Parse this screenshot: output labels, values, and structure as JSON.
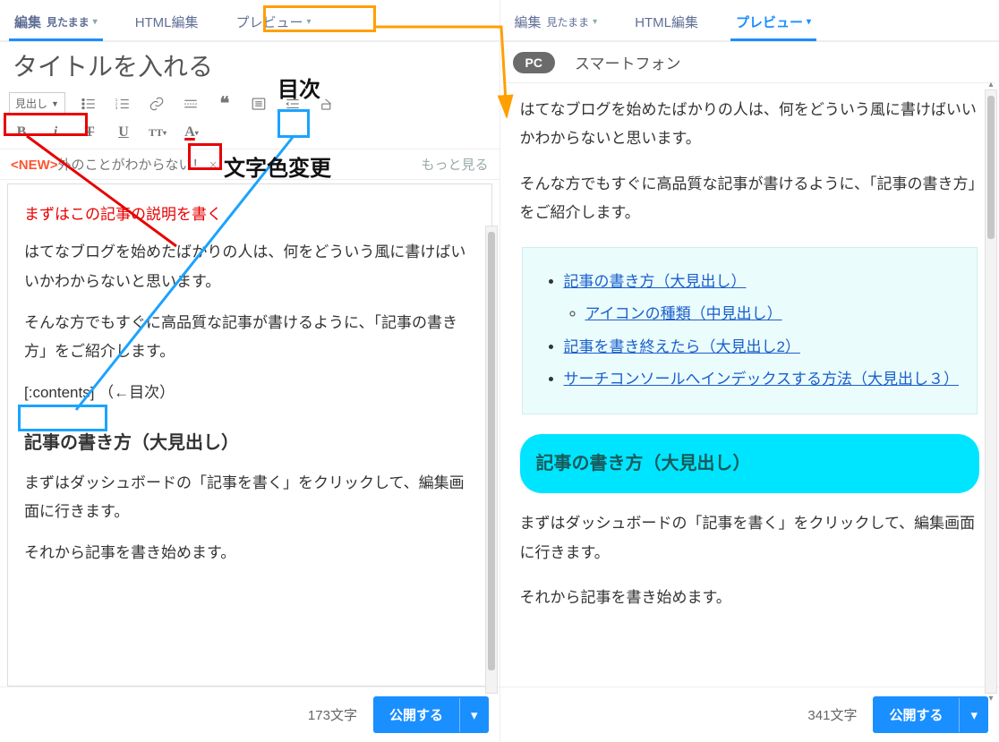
{
  "left": {
    "tabs": {
      "edit": "編集",
      "edit_small": "見たまま",
      "html": "HTML編集",
      "preview": "プレビュー"
    },
    "title_value": "タイトルを入れる",
    "heading_select": "見出し",
    "notice_new": "<NEW>",
    "notice_body": "外のことがわからない！",
    "notice_close": "×",
    "notice_more": "もっと見る",
    "body": {
      "red_line": "まずはこの記事の説明を書く",
      "p1": "はてなブログを始めたばかりの人は、何をどういう風に書けばいいかわからないと思います。",
      "p2": "そんな方でもすぐに高品質な記事が書けるように、「記事の書き方」をご紹介します。",
      "contents_tag": "[:contents]",
      "contents_note": "（←目次）",
      "h3": "記事の書き方（大見出し）",
      "p3": "まずはダッシュボードの「記事を書く」をクリックして、編集画面に行きます。",
      "p4": "それから記事を書き始めます。"
    },
    "char_count": "173文字",
    "publish": "公開する"
  },
  "right": {
    "tabs": {
      "edit": "編集",
      "edit_small": "見たまま",
      "html": "HTML編集",
      "preview": "プレビュー"
    },
    "subtabs": {
      "pc": "PC",
      "sp": "スマートフォン"
    },
    "body": {
      "p1": "はてなブログを始めたばかりの人は、何をどういう風に書けばいいかわからないと思います。",
      "p2": "そんな方でもすぐに高品質な記事が書けるように、「記事の書き方」をご紹介します。",
      "toc": {
        "i1": "記事の書き方（大見出し）",
        "i1a": "アイコンの種類（中見出し）",
        "i2": "記事を書き終えたら（大見出し2）",
        "i3": "サーチコンソールへインデックスする方法（大見出し３）"
      },
      "h3": "記事の書き方（大見出し）",
      "p3": "まずはダッシュボードの「記事を書く」をクリックして、編集画面に行きます。",
      "p4": "それから記事を書き始めます。"
    },
    "char_count": "341文字",
    "publish": "公開する"
  },
  "annotations": {
    "mokuji": "目次",
    "color_change": "文字色変更"
  }
}
